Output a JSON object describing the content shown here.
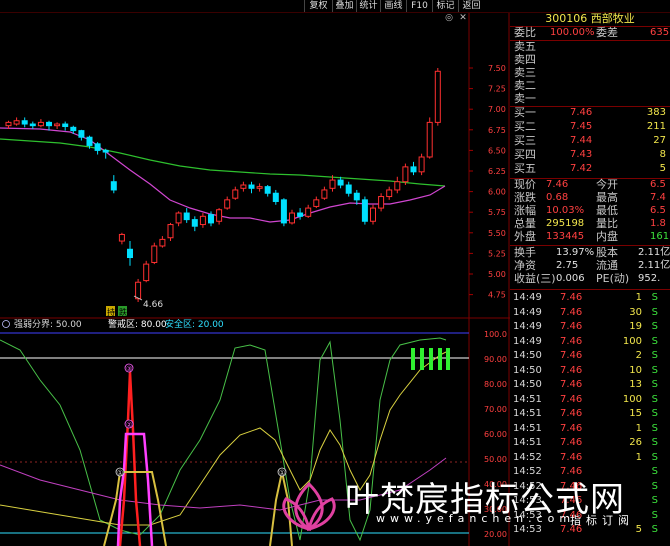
{
  "toolbar": {
    "buttons": [
      "复权",
      "叠加",
      "统计",
      "画线",
      "F10",
      "标记",
      "返回"
    ],
    "icons": [
      "restore-icon",
      "close-icon"
    ]
  },
  "stock": {
    "code": "300106",
    "name": "西部牧业"
  },
  "order_book": {
    "weibi_label": "委比",
    "weibi_value": "100.00%",
    "weicha_label": "委差",
    "weicha_value": "635",
    "sells": [
      {
        "label": "卖五",
        "price": "",
        "vol": ""
      },
      {
        "label": "卖四",
        "price": "",
        "vol": ""
      },
      {
        "label": "卖三",
        "price": "",
        "vol": ""
      },
      {
        "label": "卖二",
        "price": "",
        "vol": ""
      },
      {
        "label": "卖一",
        "price": "",
        "vol": ""
      }
    ],
    "buys": [
      {
        "label": "买一",
        "price": "7.46",
        "vol": "383"
      },
      {
        "label": "买二",
        "price": "7.45",
        "vol": "211"
      },
      {
        "label": "买三",
        "price": "7.44",
        "vol": "27"
      },
      {
        "label": "买四",
        "price": "7.43",
        "vol": "8"
      },
      {
        "label": "买五",
        "price": "7.42",
        "vol": "5"
      }
    ]
  },
  "quote": {
    "rows": [
      [
        {
          "l": "现价",
          "v": "7.46"
        },
        {
          "l": "今开",
          "v": "6.5"
        }
      ],
      [
        {
          "l": "涨跌",
          "v": "0.68"
        },
        {
          "l": "最高",
          "v": "7.4"
        }
      ],
      [
        {
          "l": "涨幅",
          "v": "10.03%"
        },
        {
          "l": "最低",
          "v": "6.5"
        }
      ],
      [
        {
          "l": "总量",
          "v": "295198"
        },
        {
          "l": "量比",
          "v": "1.8"
        }
      ],
      [
        {
          "l": "外盘",
          "v": "133445"
        },
        {
          "l": "内盘",
          "v": "16175"
        }
      ]
    ],
    "rows2": [
      [
        {
          "l": "换手",
          "v": "13.97%"
        },
        {
          "l": "股本",
          "v": "2.11亿"
        }
      ],
      [
        {
          "l": "净资",
          "v": "2.75"
        },
        {
          "l": "流通",
          "v": "2.11亿"
        }
      ],
      [
        {
          "l": "收益(三)",
          "v": "0.006"
        },
        {
          "l": "PE(动)",
          "v": "952."
        }
      ]
    ]
  },
  "ticks": [
    {
      "t": "14:49",
      "p": "7.46",
      "v": "1",
      "s": "S"
    },
    {
      "t": "14:49",
      "p": "7.46",
      "v": "30",
      "s": "S"
    },
    {
      "t": "14:49",
      "p": "7.46",
      "v": "19",
      "s": "S"
    },
    {
      "t": "14:49",
      "p": "7.46",
      "v": "100",
      "s": "S"
    },
    {
      "t": "14:50",
      "p": "7.46",
      "v": "2",
      "s": "S"
    },
    {
      "t": "14:50",
      "p": "7.46",
      "v": "10",
      "s": "S"
    },
    {
      "t": "14:50",
      "p": "7.46",
      "v": "13",
      "s": "S"
    },
    {
      "t": "14:51",
      "p": "7.46",
      "v": "100",
      "s": "S"
    },
    {
      "t": "14:51",
      "p": "7.46",
      "v": "15",
      "s": "S"
    },
    {
      "t": "14:51",
      "p": "7.46",
      "v": "1",
      "s": "S"
    },
    {
      "t": "14:51",
      "p": "7.46",
      "v": "26",
      "s": "S"
    },
    {
      "t": "14:52",
      "p": "7.46",
      "v": "1",
      "s": "S"
    },
    {
      "t": "14:52",
      "p": "7.46",
      "v": "",
      "s": "S"
    },
    {
      "t": "14:52",
      "p": "7.46",
      "v": "",
      "s": "S"
    },
    {
      "t": "14:53",
      "p": "7.46",
      "v": "",
      "s": "S"
    },
    {
      "t": "14:53",
      "p": "7.46",
      "v": "",
      "s": "S"
    },
    {
      "t": "14:53",
      "p": "7.46",
      "v": "5",
      "s": "S"
    }
  ],
  "price_chart": {
    "axis_ticks": [
      "7.50",
      "7.25",
      "7.00",
      "6.75",
      "6.50",
      "6.25",
      "6.00",
      "5.75",
      "5.50",
      "5.25",
      "5.00",
      "4.75"
    ],
    "low_label": "4.66",
    "buy_tag": "持",
    "sell_tag": "跌"
  },
  "indicator": {
    "label_main": "强弱分界: 50.00",
    "label_warn": "警戒区: 80.00",
    "label_safe": "安全区: 20.00",
    "axis_ticks": [
      "100.0",
      "90.00",
      "80.00",
      "70.00",
      "60.00",
      "50.00",
      "40.00",
      "30.00",
      "20.00"
    ],
    "markers": [
      "③",
      "②",
      "①",
      "①"
    ]
  },
  "watermark": {
    "title": "叶梵宸指标公式网",
    "url": "www.yefanchen.com",
    "url_tail": "指标订阅"
  },
  "colors": {
    "up": "#ff3030",
    "down": "#00e0ff",
    "ma_short": "#d046d0",
    "ma_long": "#2ec02e",
    "grid": "#7a0000"
  }
}
